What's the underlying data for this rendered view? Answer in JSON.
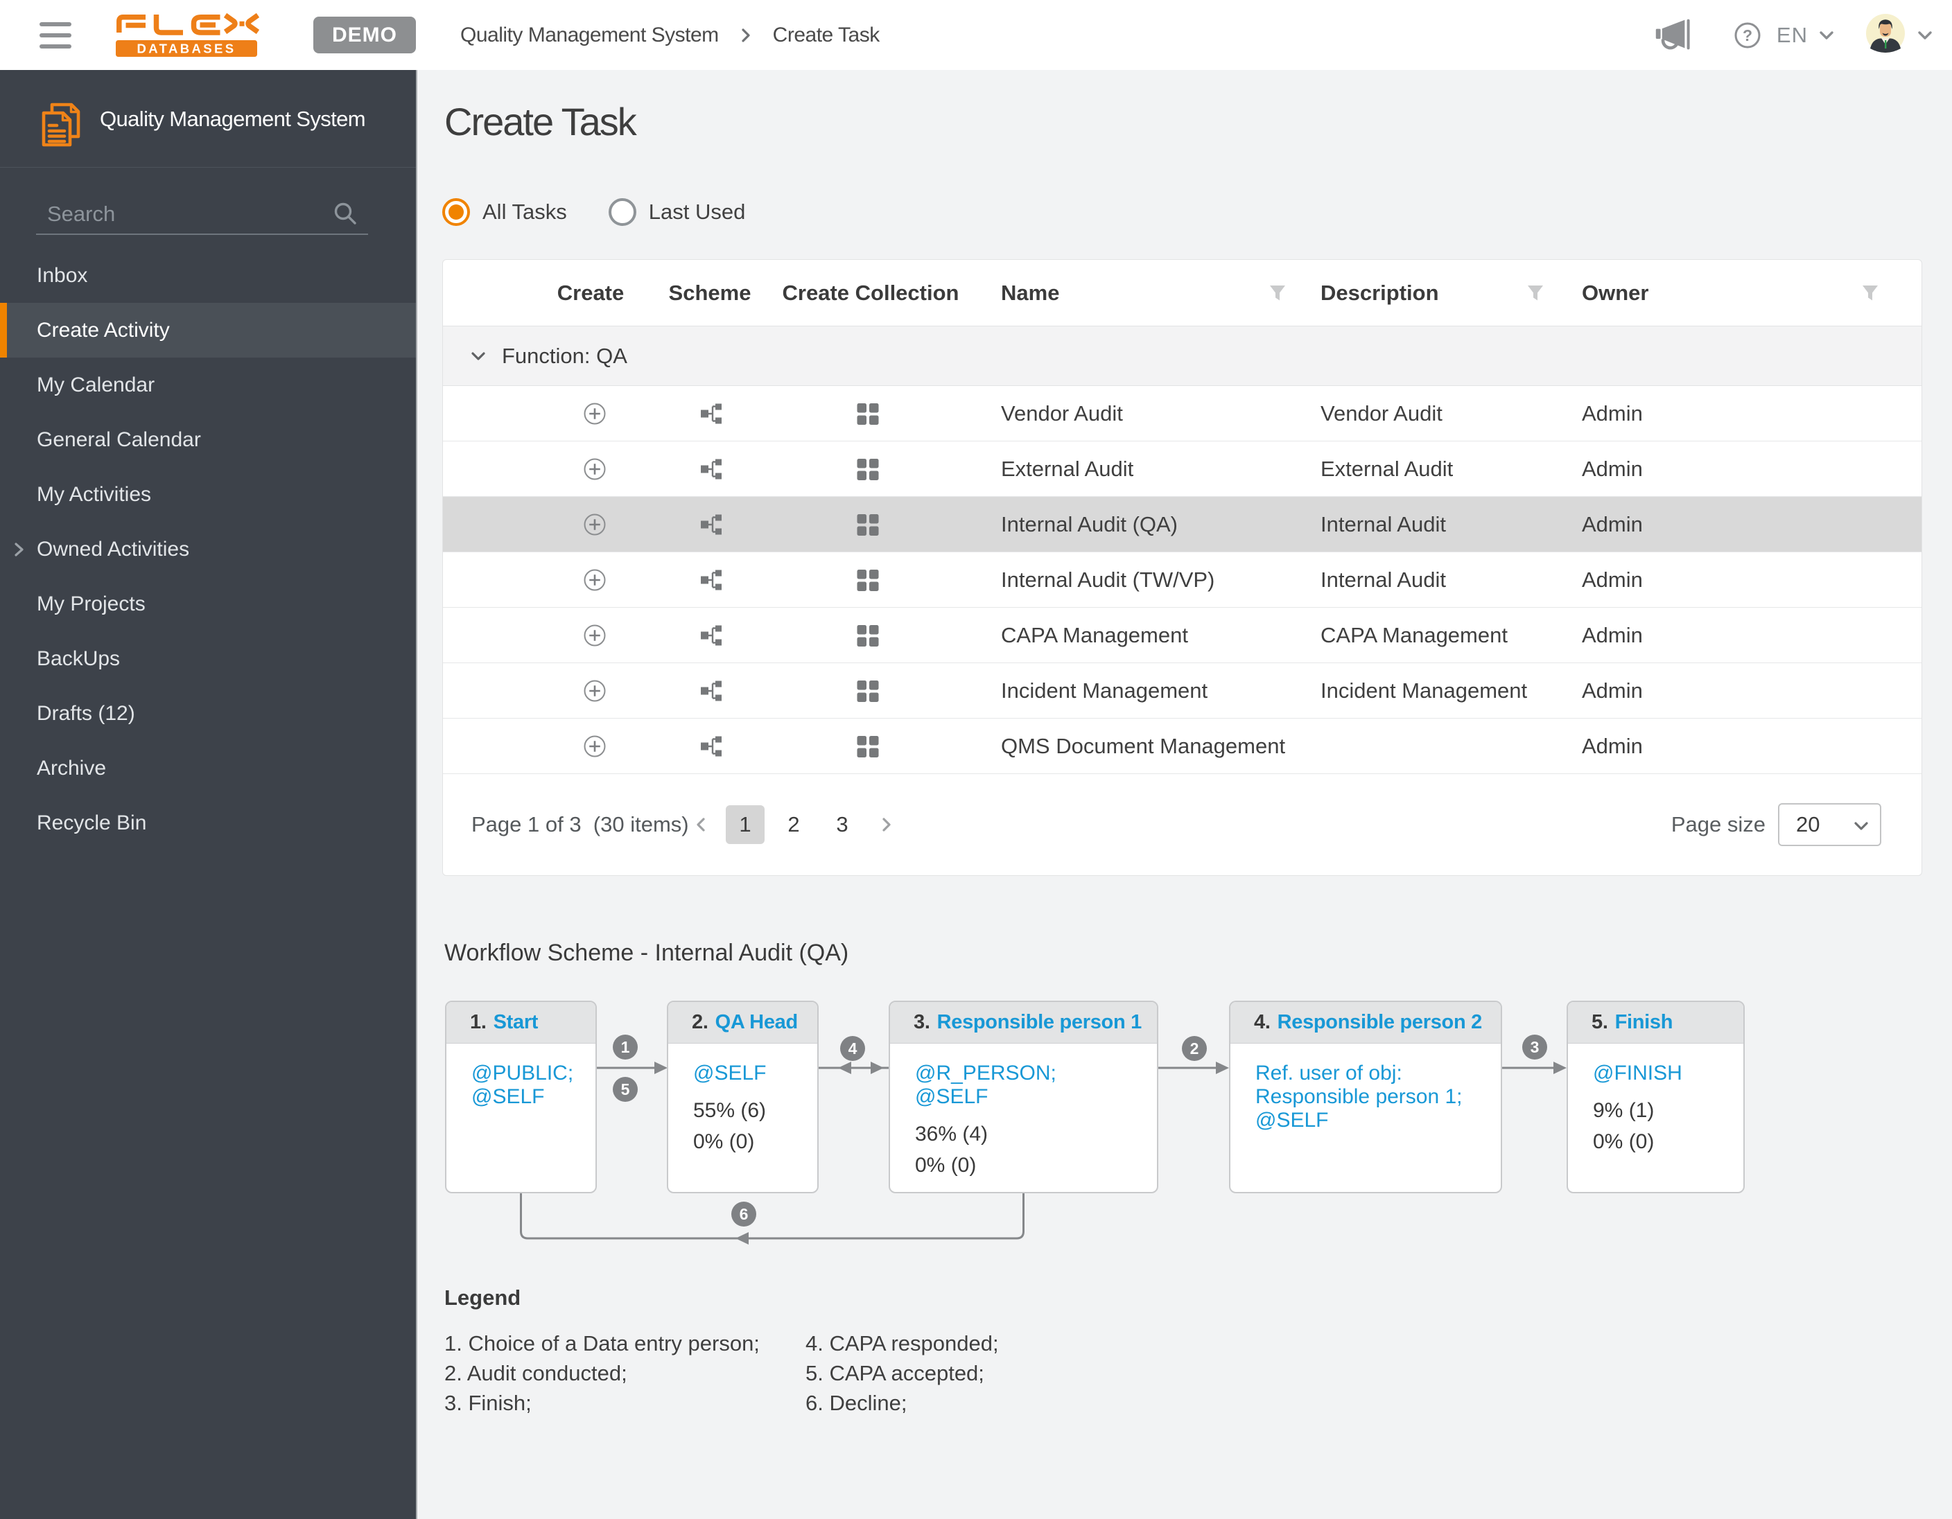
{
  "topbar": {
    "logo_word": "FLEX",
    "logo_sub": "DATABASES",
    "demo_label": "DEMO",
    "breadcrumb": {
      "parent": "Quality Management System",
      "current": "Create Task"
    },
    "language": "EN"
  },
  "sidebar": {
    "title": "Quality Management System",
    "search_placeholder": "Search",
    "items": [
      {
        "label": "Inbox"
      },
      {
        "label": "Create Activity",
        "active": true
      },
      {
        "label": "My Calendar"
      },
      {
        "label": "General Calendar"
      },
      {
        "label": "My Activities"
      },
      {
        "label": "Owned Activities",
        "expandable": true
      },
      {
        "label": "My Projects"
      },
      {
        "label": "BackUps"
      },
      {
        "label": "Drafts (12)"
      },
      {
        "label": "Archive"
      },
      {
        "label": "Recycle Bin"
      }
    ]
  },
  "page": {
    "title": "Create Task",
    "filters": [
      {
        "label": "All Tasks",
        "selected": true
      },
      {
        "label": "Last Used",
        "selected": false
      }
    ]
  },
  "table": {
    "columns": {
      "create": "Create",
      "scheme": "Scheme",
      "collection": "Create Collection",
      "name": "Name",
      "description": "Description",
      "owner": "Owner"
    },
    "group_label": "Function: QA",
    "rows": [
      {
        "name": "Vendor Audit",
        "description": "Vendor Audit",
        "owner": "Admin"
      },
      {
        "name": "External Audit",
        "description": "External Audit",
        "owner": "Admin"
      },
      {
        "name": "Internal Audit (QA)",
        "description": "Internal Audit",
        "owner": "Admin",
        "highlighted": true
      },
      {
        "name": "Internal Audit (TW/VP)",
        "description": "Internal Audit",
        "owner": "Admin"
      },
      {
        "name": "CAPA Management",
        "description": "CAPA Management",
        "owner": "Admin"
      },
      {
        "name": "Incident Management",
        "description": "Incident Management",
        "owner": "Admin"
      },
      {
        "name": "QMS Document Management",
        "description": "",
        "owner": "Admin"
      }
    ],
    "pagination": {
      "summary": "Page 1 of 3  (30 items)",
      "pages": [
        {
          "num": "1",
          "current": true
        },
        {
          "num": "2"
        },
        {
          "num": "3"
        }
      ],
      "page_size_label": "Page size",
      "page_size": "20"
    }
  },
  "workflow": {
    "title": "Workflow Scheme - Internal Audit (QA)",
    "boxes": [
      {
        "num": "1.",
        "name": "Start",
        "roles": [
          "@PUBLIC;",
          "@SELF"
        ],
        "stats": []
      },
      {
        "num": "2.",
        "name": "QA Head",
        "roles": [
          "@SELF"
        ],
        "stats": [
          "55% (6)",
          "0% (0)"
        ]
      },
      {
        "num": "3.",
        "name": "Responsible person 1",
        "roles": [
          "@R_PERSON;",
          "@SELF"
        ],
        "stats": [
          "36% (4)",
          "0% (0)"
        ]
      },
      {
        "num": "4.",
        "name": "Responsible person 2",
        "roles": [
          "Ref. user of obj:",
          "Responsible person 1;",
          "@SELF"
        ],
        "stats": []
      },
      {
        "num": "5.",
        "name": "Finish",
        "roles": [
          "@FINISH"
        ],
        "stats": [
          "9% (1)",
          "0% (0)"
        ]
      }
    ],
    "transitions": [
      "1",
      "5",
      "4",
      "2",
      "3",
      "6"
    ]
  },
  "legend": {
    "title": "Legend",
    "col1": [
      "1. Choice of a Data entry person;",
      "2. Audit conducted;",
      "3. Finish;"
    ],
    "col2": [
      "4. CAPA responded;",
      "5. CAPA accepted;",
      "6. Decline;"
    ]
  },
  "colors": {
    "accent": "#ef8300",
    "logo_orange": "#ee7f18",
    "blue": "#1898d6",
    "sidebar": "#3d424a"
  }
}
